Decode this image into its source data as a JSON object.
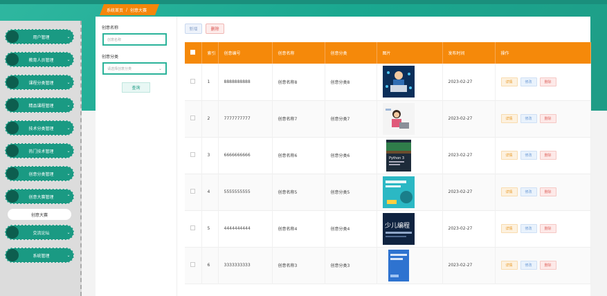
{
  "breadcrumb": {
    "home": "系统首页",
    "separator": "/",
    "current": "创意大赛"
  },
  "sidebar": {
    "items": [
      {
        "label": "用户管理",
        "chevron": "⌄"
      },
      {
        "label": "教育人员管理",
        "chevron": "⌄"
      },
      {
        "label": "课程分类管理",
        "chevron": "⌄"
      },
      {
        "label": "精品课程管理",
        "chevron": "⌄"
      },
      {
        "label": "技术分类管理",
        "chevron": "⌄"
      },
      {
        "label": "热门技术管理",
        "chevron": "⌄"
      },
      {
        "label": "创意分类管理",
        "chevron": "⌄"
      },
      {
        "label": "创意大赛管理",
        "chevron": "⌃"
      },
      {
        "label": "交流论坛",
        "chevron": "⌄"
      },
      {
        "label": "系统管理",
        "chevron": "⌄"
      }
    ],
    "sub_item": "创意大赛"
  },
  "filters": {
    "name_label": "创意名称",
    "name_placeholder": "创意名称",
    "category_label": "创意分类",
    "category_placeholder": "请选择创意分类",
    "query_button": "查询"
  },
  "toolbar": {
    "add": "新增",
    "delete": "删除"
  },
  "table": {
    "headers": [
      "",
      "索引",
      "创意编号",
      "创意名称",
      "创意分类",
      "图片",
      "发布时间",
      "操作"
    ],
    "actions": {
      "detail": "详情",
      "edit": "修改",
      "remove": "删除"
    },
    "rows": [
      {
        "index": "1",
        "code": "8888888888",
        "name": "创意名称8",
        "category": "创意分类8",
        "date": "2023-02-27",
        "image_icon": "boy-laptop-image"
      },
      {
        "index": "2",
        "code": "7777777777",
        "name": "创意名称7",
        "category": "创意分类7",
        "date": "2023-02-27",
        "image_icon": "girl-laptop-image"
      },
      {
        "index": "3",
        "code": "6666666666",
        "name": "创意名称6",
        "category": "创意分类6",
        "date": "2023-02-27",
        "image_icon": "python-book-cover"
      },
      {
        "index": "4",
        "code": "5555555555",
        "name": "创意名称5",
        "category": "创意分类5",
        "date": "2023-02-27",
        "image_icon": "teal-book-cover"
      },
      {
        "index": "5",
        "code": "4444444444",
        "name": "创意名称4",
        "category": "创意分类4",
        "date": "2023-02-27",
        "image_icon": "kids-programming-book-cover"
      },
      {
        "index": "6",
        "code": "3333333333",
        "name": "创意名称3",
        "category": "创意分类3",
        "date": "2023-02-27",
        "image_icon": "blue-book-cover"
      }
    ],
    "image_texts": {
      "python_title": "Python 3",
      "kids_title": "少儿编程"
    }
  },
  "colors": {
    "accent": "#f5890a",
    "teal": "#1a9a83",
    "teal_dark": "#0d5e4f"
  }
}
